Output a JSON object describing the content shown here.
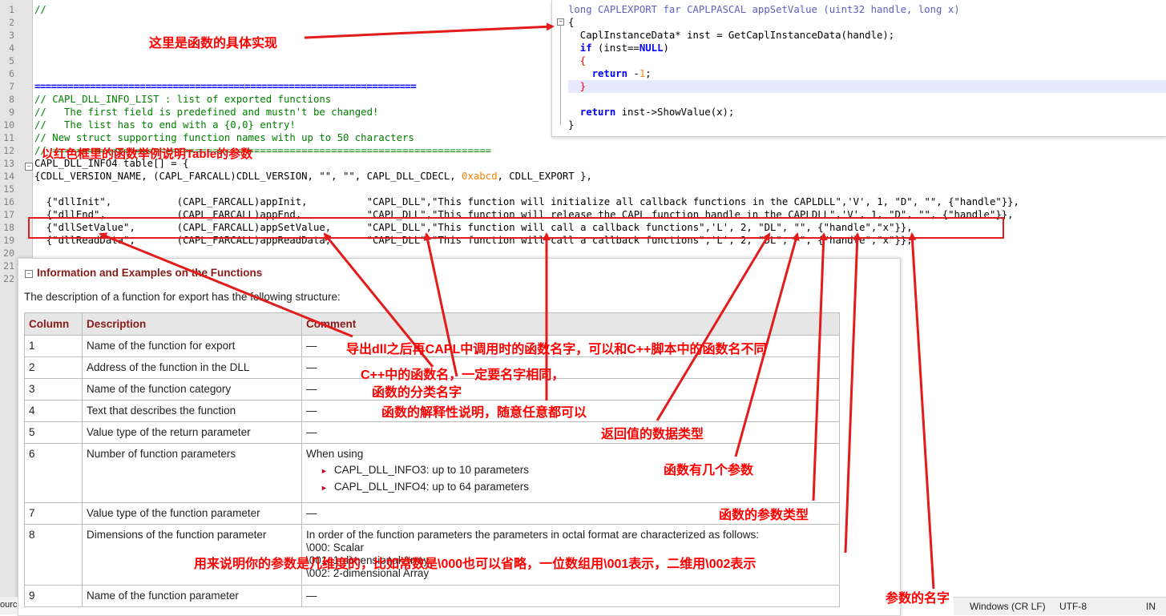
{
  "editor": {
    "line_numbers": [
      "1",
      "2",
      "3",
      "4",
      "5",
      "6",
      "7",
      "8",
      "9",
      "10",
      "11",
      "12",
      "13",
      "14",
      "15",
      "16",
      "17",
      "18",
      "19",
      "20",
      "21",
      "22"
    ],
    "line1": "//",
    "line7": "=====================================================================",
    "line8": "// CAPL_DLL_INFO_LIST : list of exported functions",
    "line9": "//   The first field is predefined and mustn't be changed!",
    "line10": "//   The list has to end with a {0,0} entry!",
    "line11": "// New struct supporting function names with up to 50 characters",
    "line12": "// ==========================================================================",
    "line13": "CAPL_DLL_INFO4 table[] = {",
    "line14a": "{CDLL_VERSION_NAME, (CAPL_FARCALL)CDLL_VERSION, \"\", \"\", CAPL_DLL_CDECL, ",
    "line14b": "0xabcd",
    "line14c": ", CDLL_EXPORT },",
    "line16": "  {\"dllInit\",           (CAPL_FARCALL)appInit,          \"CAPL_DLL\",\"This function will initialize all callback functions in the CAPLDLL\",'V', 1, \"D\", \"\", {\"handle\"}},",
    "line17": "  {\"dllEnd\",            (CAPL_FARCALL)appEnd,           \"CAPL_DLL\",\"This function will release the CAPL function handle in the CAPLDLL\",'V', 1, \"D\", \"\", {\"handle\"}},",
    "line18": "  {\"dllSetValue\",       (CAPL_FARCALL)appSetValue,      \"CAPL_DLL\",\"This function will call a callback functions\",'L', 2, \"DL\", \"\", {\"handle\",\"x\"}},",
    "line19": "  {\"dllReadData\",       (CAPL_FARCALL)appReadData,      \"CAPL_DLL\",\"This function will call a callback functions\",'L', 2, \"DL\", \"\", {\"handle\",\"x\"}},"
  },
  "popup": {
    "l1a": "long",
    "l1b": " CAPLEXPORT far CAPLPASCAL appSetValue (uint32 handle, ",
    "l1c": "long",
    "l1d": " x)",
    "l2": "{",
    "l3": "  CaplInstanceData* inst = GetCaplInstanceData(handle);",
    "l4a": "  if",
    "l4b": " (inst==",
    "l4c": "NULL",
    "l4d": ")",
    "l5": "  {",
    "l6a": "    return",
    "l6b": " -",
    "l6c": "1",
    "l6d": ";",
    "l7": "  }",
    "l9a": "  return",
    "l9b": " inst->ShowValue(x);",
    "l10": "}"
  },
  "info": {
    "title": "Information and Examples on the Functions",
    "desc": "The description of a function for export has the following structure:",
    "headers": [
      "Column",
      "Description",
      "Comment"
    ],
    "rows": [
      {
        "col": "1",
        "desc": "Name of the function for export",
        "comment": "—"
      },
      {
        "col": "2",
        "desc": "Address of the function in the DLL",
        "comment": "—"
      },
      {
        "col": "3",
        "desc": "Name of the function category",
        "comment": "—"
      },
      {
        "col": "4",
        "desc": "Text that describes the function",
        "comment": "—"
      },
      {
        "col": "5",
        "desc": "Value type of the return parameter",
        "comment": "—"
      },
      {
        "col": "6",
        "desc": "Number of function parameters",
        "comment": "When using",
        "bullets": [
          "CAPL_DLL_INFO3: up to 10 parameters",
          "CAPL_DLL_INFO4: up to 64 parameters"
        ]
      },
      {
        "col": "7",
        "desc": "Value type of the function parameter",
        "comment": "—"
      },
      {
        "col": "8",
        "desc": "Dimensions of the function parameter",
        "comment": "In order of the function parameters the parameters in octal format are characterized as follows:",
        "lines": [
          "\\000: Scalar",
          "\\001: 1-dimensional Array",
          "\\002: 2-dimensional Array"
        ]
      },
      {
        "col": "9",
        "desc": "Name of the function parameter",
        "comment": "—"
      }
    ]
  },
  "status": {
    "left": "ourc",
    "eol": "Windows (CR LF)",
    "encoding": "UTF-8",
    "ins": "IN"
  },
  "annotations": {
    "impl": "这里是函数的具体实现",
    "table_example": "以红色框里的函数举例说明Table的参数",
    "export_name": "导出dll之后再CAPL中调用时的函数名字，可以和C++脚本中的函数名不同",
    "cpp_name": "C++中的函数名，一定要名字相同，",
    "category": "函数的分类名字",
    "explain": "函数的解释性说明，随意任意都可以",
    "return_type": "返回值的数据类型",
    "param_count": "函数有几个参数",
    "param_type": "函数的参数类型",
    "dimension": "用来说明你的参数是几维度的，比如常数是\\000也可以省略，一位数组用\\001表示，二维用\\002表示",
    "param_name": "参数的名字"
  },
  "colors": {
    "annotation": "#ff0000",
    "comment_green": "#008000",
    "keyword_blue": "#0000ff",
    "number_orange": "#ff8000",
    "header_maroon": "#8b1a1a"
  }
}
